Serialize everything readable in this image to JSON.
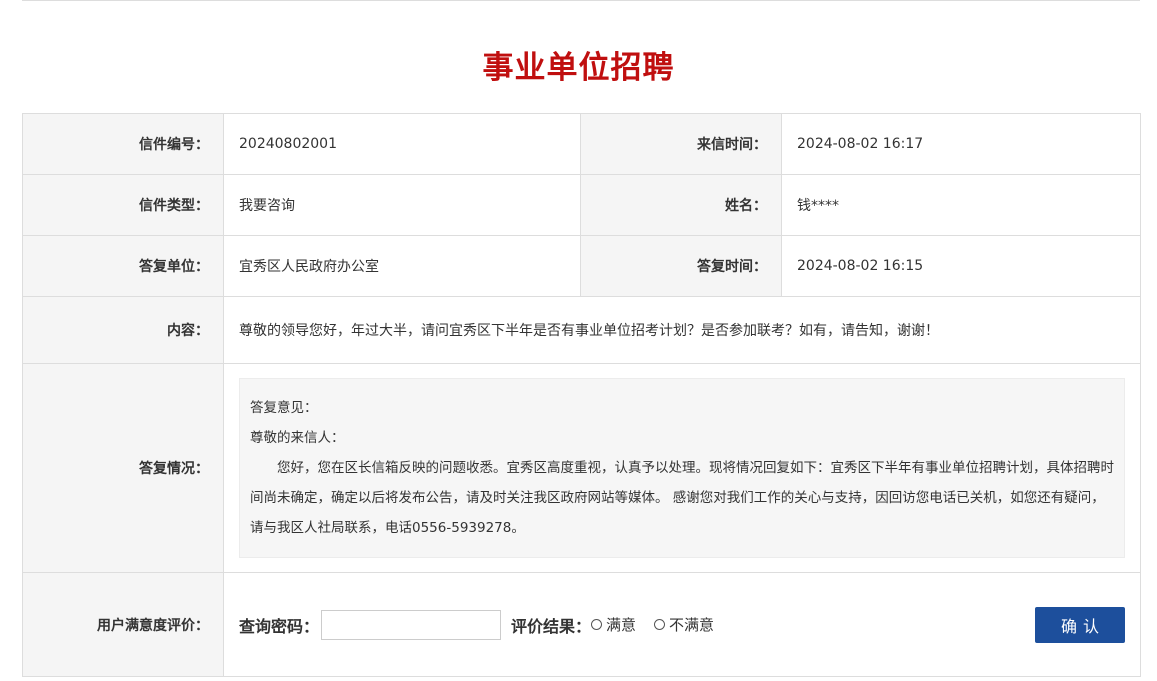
{
  "page": {
    "title": "事业单位招聘"
  },
  "letter": {
    "number_label": "信件编号：",
    "number": "20240802001",
    "received_time_label": "来信时间：",
    "received_time": "2024-08-02 16:17",
    "type_label": "信件类型：",
    "type": "我要咨询",
    "name_label": "姓名：",
    "name": "钱****",
    "reply_unit_label": "答复单位：",
    "reply_unit": "宜秀区人民政府办公室",
    "reply_time_label": "答复时间：",
    "reply_time": "2024-08-02 16:15",
    "content_label": "内容：",
    "content": "尊敬的领导您好，年过大半，请问宜秀区下半年是否有事业单位招考计划？是否参加联考？如有，请告知，谢谢！",
    "reply_label": "答复情况：",
    "reply": {
      "heading": "答复意见：",
      "greeting": "尊敬的来信人：",
      "body": "您好，您在区长信箱反映的问题收悉。宜秀区高度重视，认真予以处理。现将情况回复如下：宜秀区下半年有事业单位招聘计划，具体招聘时间尚未确定，确定以后将发布公告，请及时关注我区政府网站等媒体。 感谢您对我们工作的关心与支持，因回访您电话已关机，如您还有疑问，请与我区人社局联系，电话0556-5939278。"
    }
  },
  "evaluation": {
    "label": "用户满意度评价：",
    "password_label": "查询密码：",
    "password_value": "",
    "result_label": "评价结果：",
    "options": [
      "满意",
      "不满意"
    ],
    "confirm_label": "确认"
  },
  "colors": {
    "title": "#c00f0f",
    "button": "#1d4f9c",
    "label_bg": "#f5f5f5",
    "reply_bg": "#f6f6f6",
    "border": "#dddddd"
  }
}
